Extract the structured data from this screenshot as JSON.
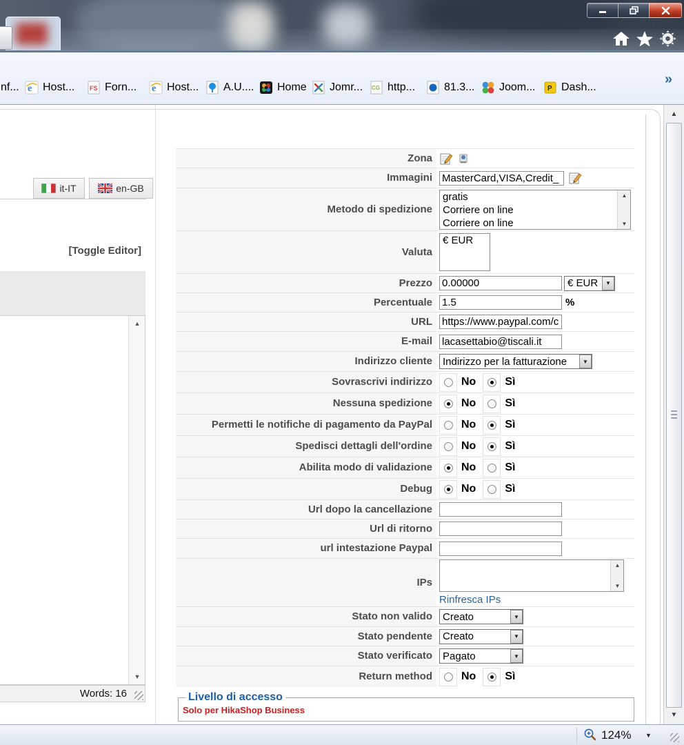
{
  "window": {
    "minimize": "minimize",
    "restore": "restore",
    "close": "close"
  },
  "browser": {
    "home": "home",
    "favorites": "star",
    "tools": "gear",
    "overflow_chevron": "»"
  },
  "favorites_bar": {
    "items": [
      {
        "label": "nf...",
        "icon": "clipped"
      },
      {
        "label": "Host...",
        "icon": "ie"
      },
      {
        "label": "Forn...",
        "icon": "fs-page"
      },
      {
        "label": "Host...",
        "icon": "ie"
      },
      {
        "label": "A.U....",
        "icon": "tree-page"
      },
      {
        "label": "Home",
        "icon": "joomla-dark"
      },
      {
        "label": "Jomr...",
        "icon": "joomla-page"
      },
      {
        "label": "http...",
        "icon": "cg-page"
      },
      {
        "label": "81.3...",
        "icon": "dot-page"
      },
      {
        "label": "Joom...",
        "icon": "balls"
      },
      {
        "label": "Dash...",
        "icon": "p-note"
      }
    ]
  },
  "editor": {
    "tabs": [
      {
        "label": "it-IT"
      },
      {
        "label": "en-GB"
      }
    ],
    "toggle_editor": "[Toggle Editor]",
    "words": "Words: 16"
  },
  "form": {
    "rows": [
      {
        "label": "Zona"
      },
      {
        "label": "Immagini",
        "value": "MasterCard,VISA,Credit_"
      },
      {
        "label": "Metodo di spedizione",
        "options": [
          "gratis",
          "Corriere on line",
          "Corriere on line"
        ]
      },
      {
        "label": "Valuta",
        "options": [
          "€ EUR"
        ]
      },
      {
        "label": "Prezzo",
        "value": "0.00000",
        "currency": "€ EUR"
      },
      {
        "label": "Percentuale",
        "value": "1.5",
        "suffix": "%"
      },
      {
        "label": "URL",
        "value": "https://www.paypal.com/c"
      },
      {
        "label": "E-mail",
        "value": "lacasettabio@tiscali.it"
      },
      {
        "label": "Indirizzo cliente",
        "value": "Indirizzo per la fatturazione"
      },
      {
        "label": "Sovrascrivi indirizzo",
        "no": "No",
        "si": "Sì",
        "selected": "si"
      },
      {
        "label": "Nessuna spedizione",
        "no": "No",
        "si": "Sì",
        "selected": "no"
      },
      {
        "label": "Permetti le notifiche di pagamento da PayPal",
        "no": "No",
        "si": "Sì",
        "selected": "si"
      },
      {
        "label": "Spedisci dettagli dell'ordine",
        "no": "No",
        "si": "Sì",
        "selected": "si"
      },
      {
        "label": "Abilita modo di validazione",
        "no": "No",
        "si": "Sì",
        "selected": "no"
      },
      {
        "label": "Debug",
        "no": "No",
        "si": "Sì",
        "selected": "no"
      },
      {
        "label": "Url dopo la cancellazione",
        "value": ""
      },
      {
        "label": "Url di ritorno",
        "value": ""
      },
      {
        "label": "url intestazione Paypal",
        "value": ""
      },
      {
        "label": "IPs",
        "value": "",
        "link": "Rinfresca IPs"
      },
      {
        "label": "Stato non valido",
        "value": "Creato"
      },
      {
        "label": "Stato pendente",
        "value": "Creato"
      },
      {
        "label": "Stato verificato",
        "value": "Pagato"
      },
      {
        "label": "Return method",
        "no": "No",
        "si": "Sì",
        "selected": "si"
      }
    ]
  },
  "access": {
    "legend": "Livello di accesso",
    "note": "Solo per HikaShop Business"
  },
  "status_bar": {
    "zoom": "124%"
  },
  "colors": {
    "link": "#2a6496",
    "legend_blue": "#1c5fa8",
    "note_red": "#cf1d1d",
    "label_gray": "#4d4d4d",
    "close_red": "#c0392b"
  }
}
